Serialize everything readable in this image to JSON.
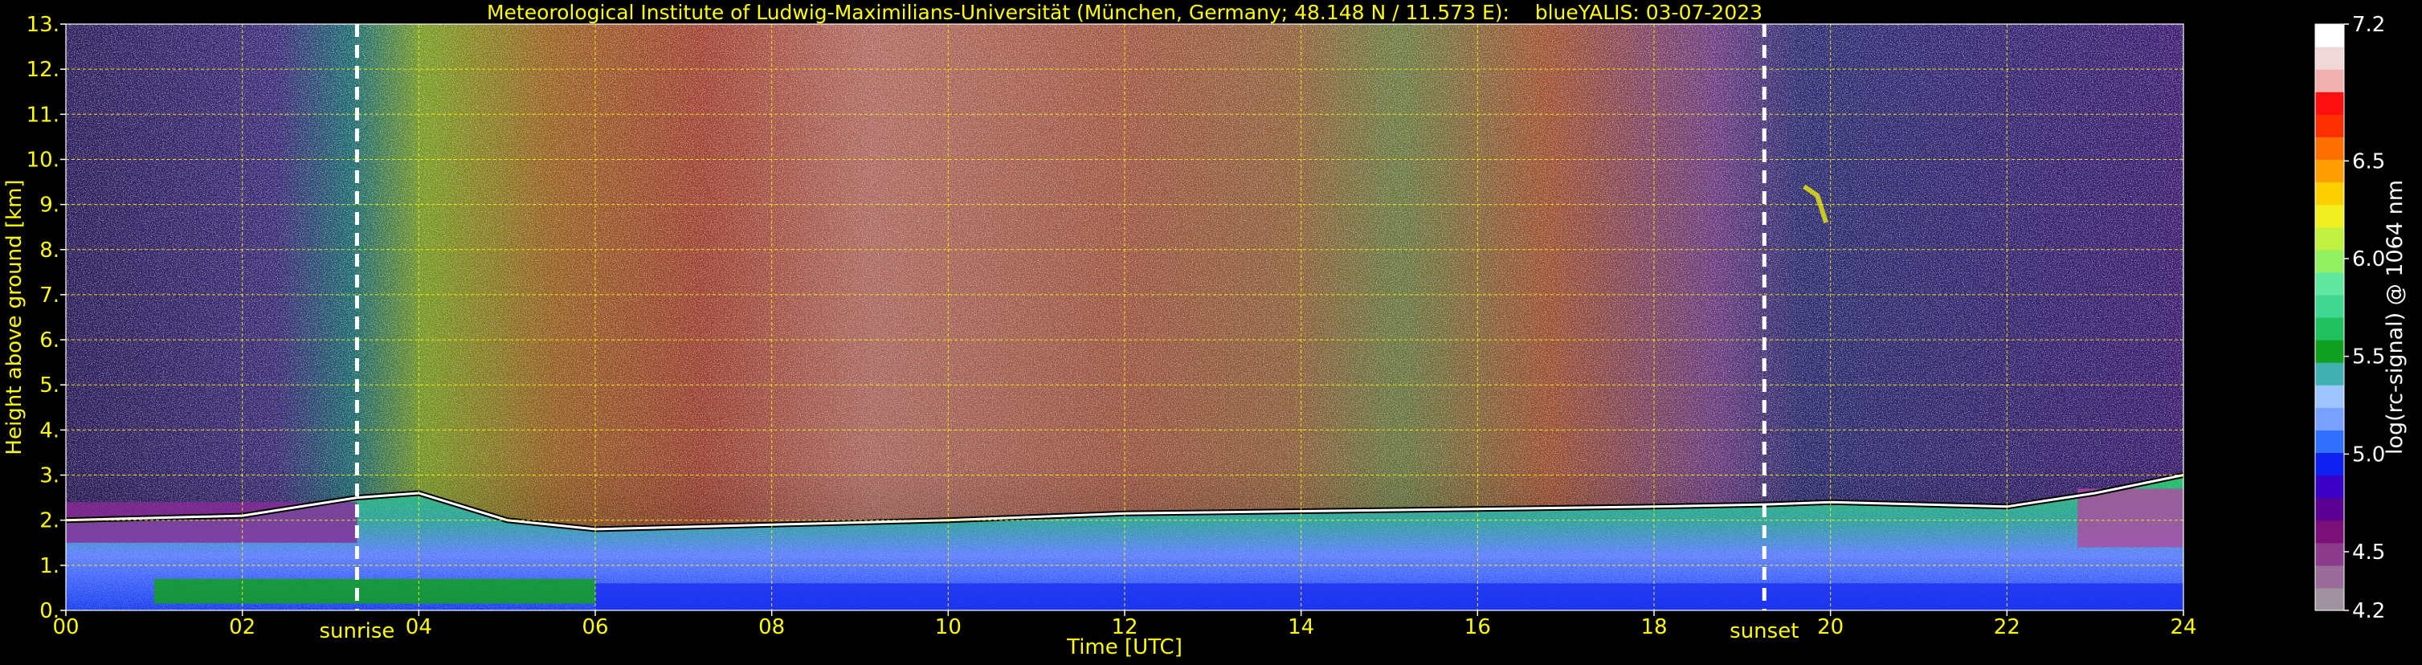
{
  "chart_data": {
    "type": "heatmap",
    "title": "Meteorological Institute of Ludwig-Maximilians-Universität (München, Germany; 48.148 N / 11.573 E):    blueYALIS: 03-07-2023",
    "xlabel": "Time [UTC]",
    "ylabel": "Height above ground [km]",
    "xlim": [
      0,
      24
    ],
    "ylim": [
      0,
      13
    ],
    "x_ticks": [
      "00",
      "02",
      "04",
      "06",
      "08",
      "10",
      "12",
      "14",
      "16",
      "18",
      "20",
      "22",
      "24"
    ],
    "y_ticks": [
      "0.",
      "1.",
      "2.",
      "3.",
      "4.",
      "5.",
      "6.",
      "7.",
      "8.",
      "9.",
      "10.",
      "11.",
      "12.",
      "13."
    ],
    "grid": true,
    "colorbar": {
      "label": "log(rc-signal) @ 1064 nm",
      "range": [
        4.2,
        7.2
      ],
      "ticks": [
        "4.2",
        "4.5",
        "5.0",
        "5.5",
        "6.0",
        "6.5",
        "7.2"
      ],
      "tick_values": [
        4.2,
        4.5,
        5.0,
        5.5,
        6.0,
        6.5,
        7.2
      ],
      "colors": [
        "#a093a0",
        "#9a6c9a",
        "#8a3c8a",
        "#7a1078",
        "#5a0090",
        "#3a00c8",
        "#1020f0",
        "#3070ff",
        "#7aa0ff",
        "#a0c4ff",
        "#40b0b0",
        "#10a020",
        "#20c060",
        "#40d890",
        "#60e8a0",
        "#90f060",
        "#c0f040",
        "#f0f020",
        "#ffd000",
        "#ffa000",
        "#ff7000",
        "#ff3000",
        "#ff1010",
        "#f0b0b0",
        "#f0d8d8",
        "#ffffff"
      ]
    },
    "annotations": [
      {
        "text": "sunrise",
        "x": 3.3
      },
      {
        "text": "sunset",
        "x": 19.25
      }
    ]
  },
  "colors": {
    "text": "#ffff00",
    "grid": "#ffff00",
    "background": "#000000"
  }
}
